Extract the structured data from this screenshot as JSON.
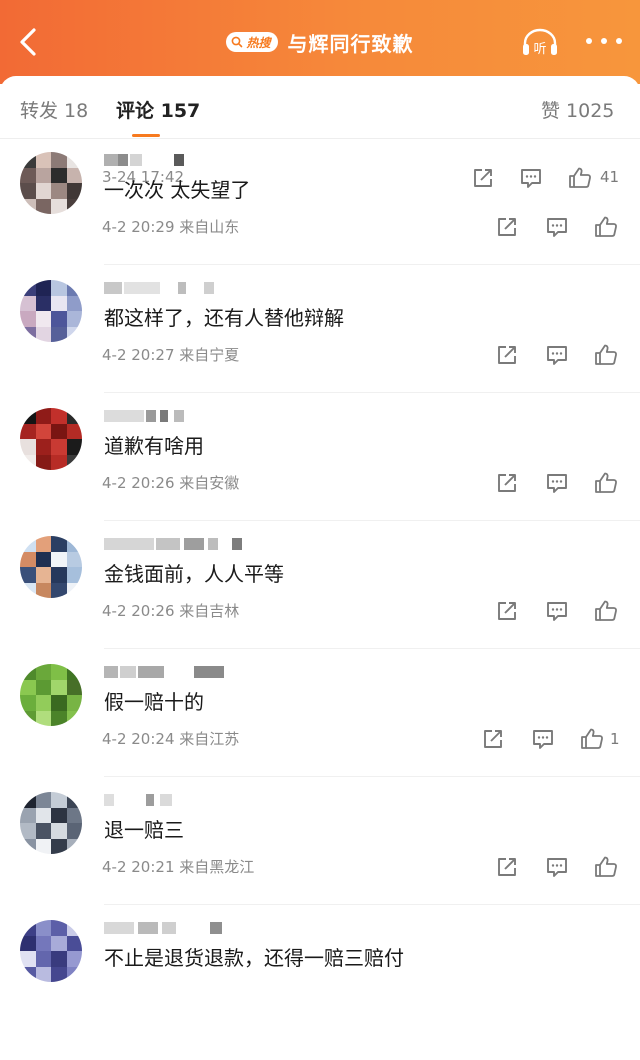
{
  "header": {
    "hot_badge": "热搜",
    "title": "与辉同行致歉",
    "listen_label": "听",
    "colors": {
      "bar_start": "#f26a35",
      "bar_end": "#f7963c",
      "accent": "#f77a1f"
    }
  },
  "tabs": [
    {
      "label": "转发 18",
      "active": false
    },
    {
      "label": "评论 157",
      "active": true
    },
    {
      "label": "赞 1025",
      "active": false
    }
  ],
  "top_item": {
    "time": "3-24 17:42",
    "like_count": "41"
  },
  "comments": [
    {
      "text": "一次次 太失望了",
      "time": "4-2 20:29",
      "location": "来自山东",
      "like_count": ""
    },
    {
      "text": "都这样了，还有人替他辩解",
      "time": "4-2 20:27",
      "location": "来自宁夏",
      "like_count": ""
    },
    {
      "text": "道歉有啥用",
      "time": "4-2 20:26",
      "location": "来自安徽",
      "like_count": ""
    },
    {
      "text": "金钱面前，人人平等",
      "time": "4-2 20:26",
      "location": "来自吉林",
      "like_count": ""
    },
    {
      "text": "假一赔十的",
      "time": "4-2 20:24",
      "location": "来自江苏",
      "like_count": "1"
    },
    {
      "text": "退一赔三",
      "time": "4-2 20:21",
      "location": "来自黑龙江",
      "like_count": ""
    },
    {
      "text": "不止是退货退款，还得一赔三赔付",
      "time": "",
      "location": "",
      "like_count": ""
    }
  ],
  "icons": [
    "back-arrow-icon",
    "search-icon",
    "headphones-icon",
    "more-icon",
    "share-icon",
    "comment-icon",
    "like-icon"
  ]
}
